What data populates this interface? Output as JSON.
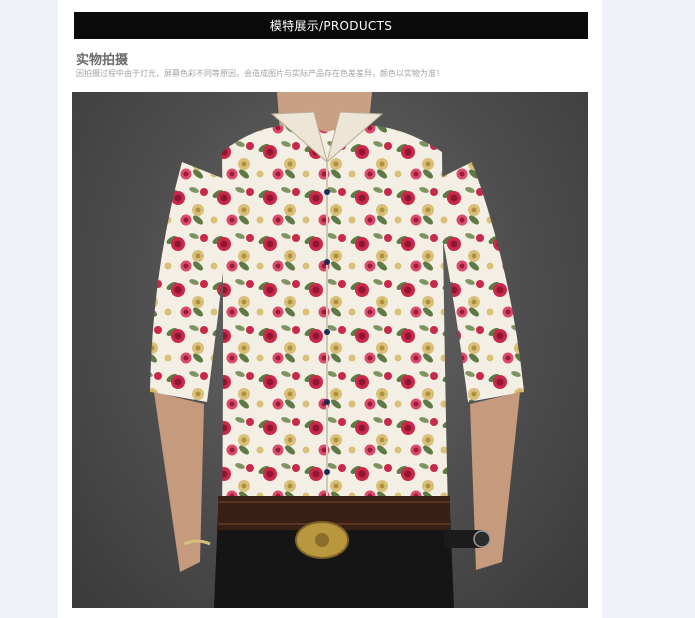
{
  "header": {
    "title": "模特展示/PRODUCTS"
  },
  "section": {
    "title": "实物拍摄",
    "description": "因拍摄过程中由于灯光，屏幕色彩不同等原因，会造成图片与实际产品存在色差差异，颜色以实物为准！"
  },
  "photo": {
    "subject": "model-wearing-floral-shirt",
    "colors": {
      "backdrop": "#4d4d4d",
      "shirt_base": "#f3efe4",
      "rose": "#c8284a",
      "leaf": "#5e7a44",
      "bud": "#d9bf77",
      "trousers": "#151515",
      "belt": "#3a1f15",
      "buckle": "#b9973f"
    }
  }
}
